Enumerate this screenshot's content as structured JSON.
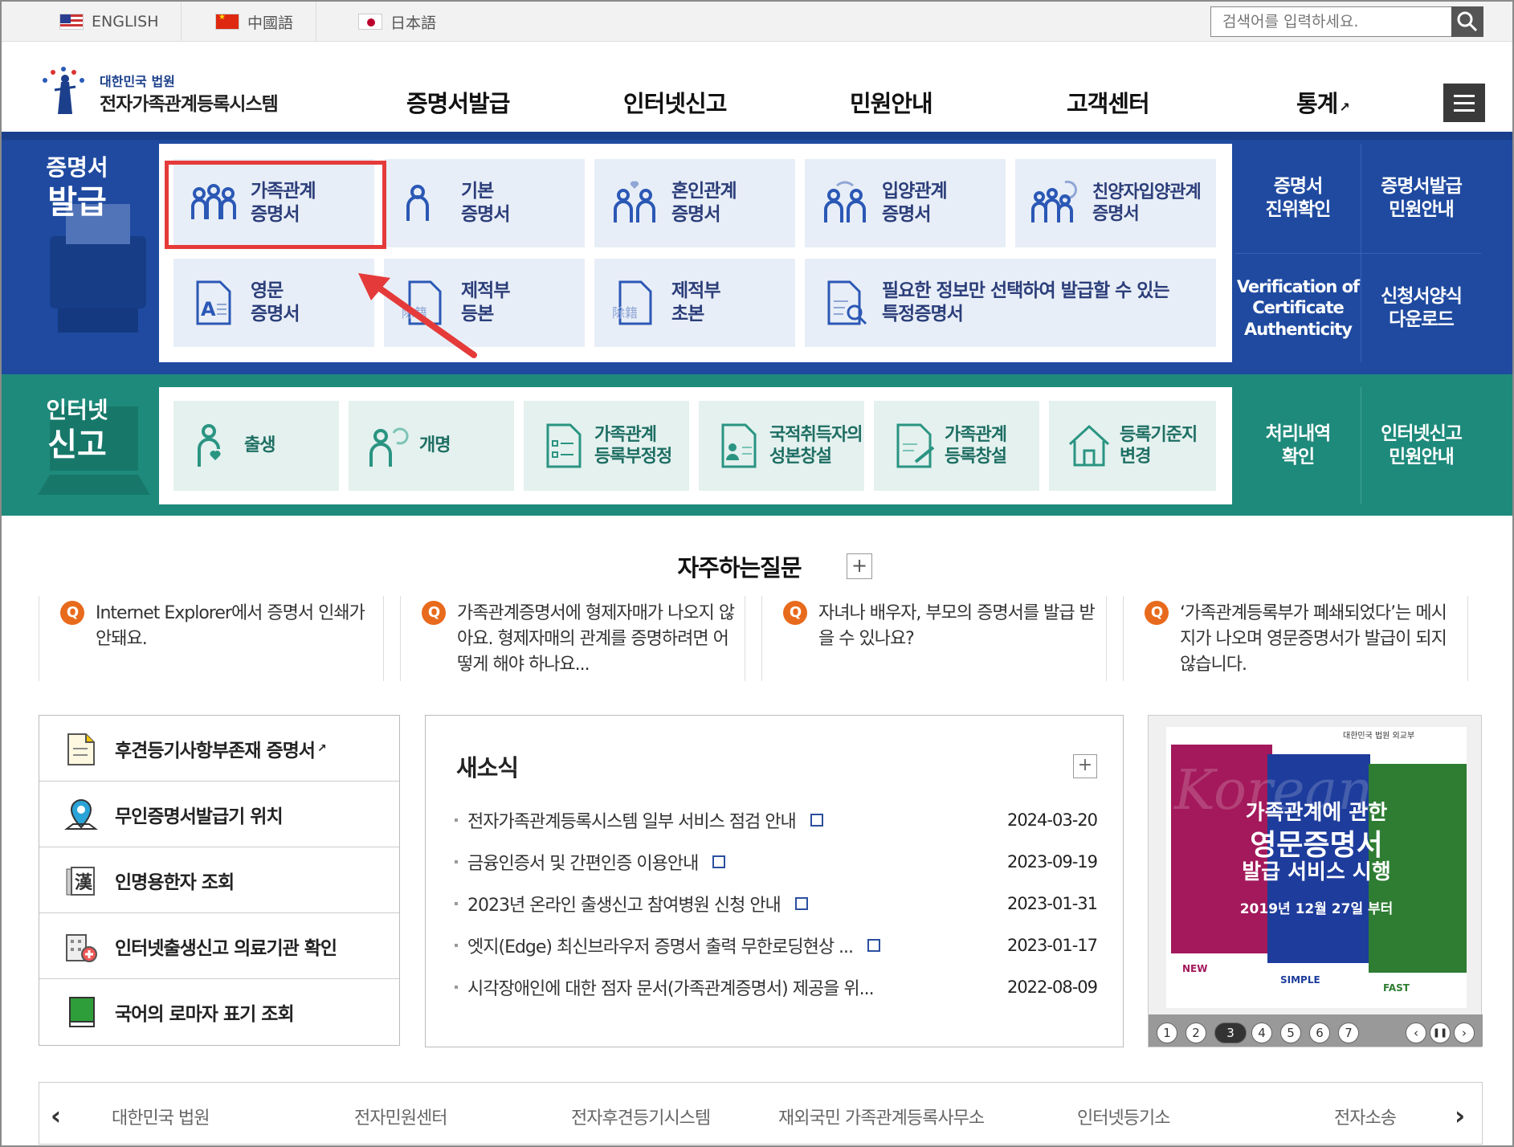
{
  "topbar": {
    "langs": [
      {
        "label": "ENGLISH",
        "flag": "us-flag-icon"
      },
      {
        "label": "中國語",
        "flag": "cn-flag-icon"
      },
      {
        "label": "日本語",
        "flag": "jp-flag-icon"
      }
    ],
    "search_placeholder": "검색어를 입력하세요."
  },
  "header": {
    "logo_top": "대한민국 법원",
    "logo_main": "전자가족관계등록시스템",
    "nav": [
      "증명서발급",
      "인터넷신고",
      "민원안내",
      "고객센터",
      "통계"
    ]
  },
  "cert": {
    "title1": "증명서",
    "title2": "발급",
    "tiles": [
      [
        "가족관계",
        "증명서"
      ],
      [
        "기본",
        "증명서"
      ],
      [
        "혼인관계",
        "증명서"
      ],
      [
        "입양관계",
        "증명서"
      ],
      [
        "친양자입양관계",
        "증명서"
      ],
      [
        "영문",
        "증명서"
      ],
      [
        "제적부",
        "등본"
      ],
      [
        "제적부",
        "초본"
      ],
      [
        "필요한 정보만 선택하여 발급할 수 있는",
        "특정증명서"
      ]
    ],
    "side": [
      [
        "증명서",
        "진위확인"
      ],
      [
        "증명서발급",
        "민원안내"
      ],
      [
        "Verification of",
        "Certificate",
        "Authenticity"
      ],
      [
        "신청서양식",
        "다운로드"
      ]
    ]
  },
  "net": {
    "title1": "인터넷",
    "title2": "신고",
    "tiles": [
      [
        "출생",
        ""
      ],
      [
        "개명",
        ""
      ],
      [
        "가족관계",
        "등록부정정"
      ],
      [
        "국적취득자의",
        "성본창설"
      ],
      [
        "가족관계",
        "등록창설"
      ],
      [
        "등록기준지",
        "변경"
      ]
    ],
    "side": [
      [
        "처리내역",
        "확인"
      ],
      [
        "인터넷신고",
        "민원안내"
      ]
    ]
  },
  "faq": {
    "title": "자주하는질문",
    "plus": "+",
    "q": "Q",
    "items": [
      "Internet Explorer에서 증명서 인쇄가 안돼요.",
      "가족관계증명서에 형제자매가 나오지 않아요. 형제자매의 관계를 증명하려면 어떻게 해야 하나요...",
      "자녀나 배우자, 부모의 증명서를 발급 받을 수 있나요?",
      "‘가족관계등록부가 폐쇄되었다’는 메시지가 나오며 영문증명서가 발급이 되지 않습니다."
    ]
  },
  "quick": [
    "후견등기사항부존재 증명서",
    "무인증명서발급기 위치",
    "인명용한자 조회",
    "인터넷출생신고 의료기관 확인",
    "국어의 로마자 표기 조회"
  ],
  "news": {
    "title": "새소식",
    "plus": "+",
    "items": [
      {
        "title": "전자가족관계등록시스템 일부 서비스 점검 안내",
        "date": "2024-03-20"
      },
      {
        "title": "금융인증서 및 간편인증 이용안내",
        "date": "2023-09-19"
      },
      {
        "title": "2023년 온라인 출생신고 참여병원 신청 안내",
        "date": "2023-01-31"
      },
      {
        "title": "엣지(Edge) 최신브라우저 증명서 출력 무한로딩현상 ...",
        "date": "2023-01-17"
      },
      {
        "title": "시각장애인에 대한 점자 문서(가족관계증명서) 제공을 위...",
        "date": "2022-08-09"
      }
    ]
  },
  "banner": {
    "org": "대한민국 법원 외교부",
    "line1": "가족관계에 관한",
    "line2": "영문증명서",
    "line3": "발급 서비스 시행",
    "line4": "2019년 12월 27일 부터",
    "bg_word": "Korean",
    "f1": "NEW",
    "f2": "SIMPLE",
    "f3": "FAST",
    "pages": [
      "1",
      "2",
      "3",
      "4",
      "5",
      "6",
      "7"
    ],
    "current": "3"
  },
  "footer": [
    "대한민국 법원",
    "전자민원센터",
    "전자후견등기시스템",
    "재외국민 가족관계등록사무소",
    "인터넷등기소",
    "전자소송"
  ],
  "colors": {
    "cert_bg": "#1f4aa0",
    "net_bg": "#1e8a7b",
    "highlight": "#e53a3a"
  }
}
